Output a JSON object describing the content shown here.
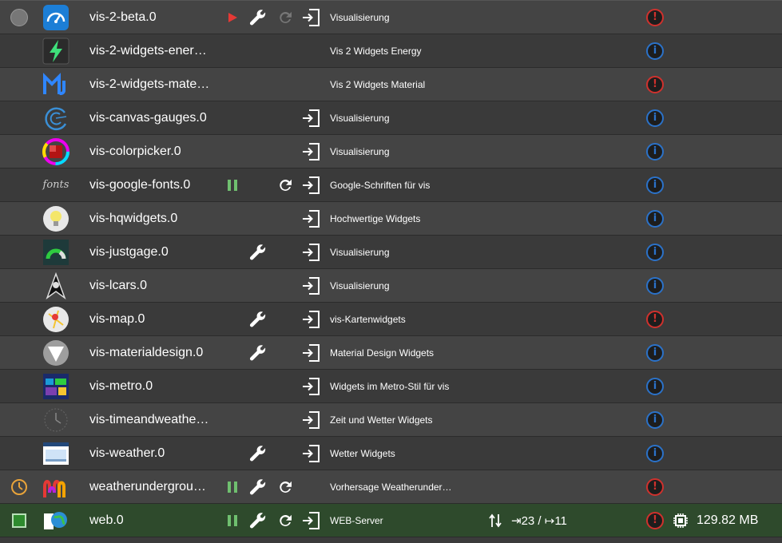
{
  "colors": {
    "row_odd": "#444444",
    "row_even": "#3a3a3a",
    "row_active": "#2e4a2c",
    "info_blue": "#2b72c9",
    "info_red": "#d0312d",
    "running_green": "#2e8b2e",
    "play_red": "#e53935"
  },
  "rows": [
    {
      "name": "vis-2-beta.0",
      "title": "Visualisierung",
      "logo_icon": "gauge-logo-icon",
      "status_icon": "stopped-circle-icon",
      "controls": [
        "play-icon",
        "wrench-icon",
        "reload-icon-dim",
        "login-icon"
      ],
      "info": "red"
    },
    {
      "name": "vis-2-widgets-ener…",
      "title": "Vis 2 Widgets Energy",
      "logo_icon": "lightning-logo-icon",
      "controls": [],
      "info": "blue"
    },
    {
      "name": "vis-2-widgets-mate…",
      "title": "Vis 2 Widgets Material",
      "logo_icon": "material-m-logo-icon",
      "controls": [],
      "info": "red"
    },
    {
      "name": "vis-canvas-gauges.0",
      "title": "Visualisierung",
      "logo_icon": "canvas-gauge-logo-icon",
      "controls": [
        "login-icon"
      ],
      "info": "blue"
    },
    {
      "name": "vis-colorpicker.0",
      "title": "Visualisierung",
      "logo_icon": "colorwheel-logo-icon",
      "controls": [
        "login-icon"
      ],
      "info": "blue"
    },
    {
      "name": "vis-google-fonts.0",
      "title": "Google-Schriften für vis",
      "logo_icon": "fonts-logo-icon",
      "logo_text": "fonts",
      "controls": [
        "pause-icon",
        "reload-icon",
        "login-icon"
      ],
      "info": "blue"
    },
    {
      "name": "vis-hqwidgets.0",
      "title": "Hochwertige Widgets",
      "logo_icon": "lightbulb-logo-icon",
      "controls": [
        "login-icon"
      ],
      "info": "blue"
    },
    {
      "name": "vis-justgage.0",
      "title": "Visualisierung",
      "logo_icon": "justgage-logo-icon",
      "controls": [
        "wrench-icon",
        "login-icon"
      ],
      "info": "blue"
    },
    {
      "name": "vis-lcars.0",
      "title": "Visualisierung",
      "logo_icon": "starfleet-logo-icon",
      "controls": [
        "login-icon"
      ],
      "info": "blue"
    },
    {
      "name": "vis-map.0",
      "title": "vis-Kartenwidgets",
      "logo_icon": "map-logo-icon",
      "controls": [
        "wrench-icon",
        "login-icon"
      ],
      "info": "red"
    },
    {
      "name": "vis-materialdesign.0",
      "title": "Material Design Widgets",
      "logo_icon": "materialdesign-logo-icon",
      "controls": [
        "wrench-icon",
        "login-icon"
      ],
      "info": "blue"
    },
    {
      "name": "vis-metro.0",
      "title": "Widgets im Metro-Stil für vis",
      "logo_icon": "metro-logo-icon",
      "controls": [
        "login-icon"
      ],
      "info": "blue"
    },
    {
      "name": "vis-timeandweathe…",
      "title": "Zeit und Wetter Widgets",
      "logo_icon": "clock-logo-icon",
      "controls": [
        "login-icon"
      ],
      "info": "blue"
    },
    {
      "name": "vis-weather.0",
      "title": "Wetter Widgets",
      "logo_icon": "weather-logo-icon",
      "controls": [
        "wrench-icon",
        "login-icon"
      ],
      "info": "blue"
    },
    {
      "name": "weatherundergrou…",
      "title": "Vorhersage Weatherunder…",
      "logo_icon": "weatherunderground-logo-icon",
      "status_icon": "schedule-clock-icon",
      "controls": [
        "pause-icon",
        "wrench-icon",
        "reload-icon"
      ],
      "info": "red"
    },
    {
      "name": "web.0",
      "title": "WEB-Server",
      "logo_icon": "web-globe-logo-icon",
      "status_icon": "running-square-icon",
      "controls": [
        "pause-icon",
        "wrench-icon",
        "reload-icon",
        "login-icon"
      ],
      "info": "red",
      "active": true,
      "connections": "⇥23 / ↦11",
      "memory": "129.82 MB"
    }
  ]
}
